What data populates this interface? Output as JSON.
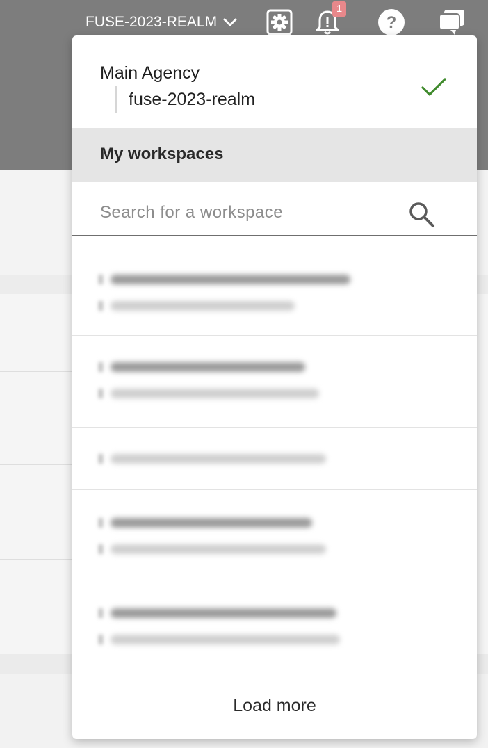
{
  "topbar": {
    "realm_label": "FUSE-2023-REALM",
    "icons": [
      "chevron-down-icon",
      "gear-icon",
      "bell-icon",
      "help-icon",
      "chat-icon"
    ],
    "notification_count": "1",
    "background_color": "#7d7d7d"
  },
  "dropdown": {
    "current": {
      "org_name": "Main Agency",
      "realm_name": "fuse-2023-realm",
      "selected": true,
      "check_color": "#3f8a2c"
    },
    "section_title": "My workspaces",
    "search": {
      "placeholder": "Search for a workspace",
      "value": ""
    },
    "workspaces": [
      {
        "redacted": true,
        "lines": 2
      },
      {
        "redacted": true,
        "lines": 2
      },
      {
        "redacted": true,
        "lines": 1
      },
      {
        "redacted": true,
        "lines": 2
      },
      {
        "redacted": true,
        "lines": 2
      }
    ],
    "load_more_label": "Load more"
  }
}
